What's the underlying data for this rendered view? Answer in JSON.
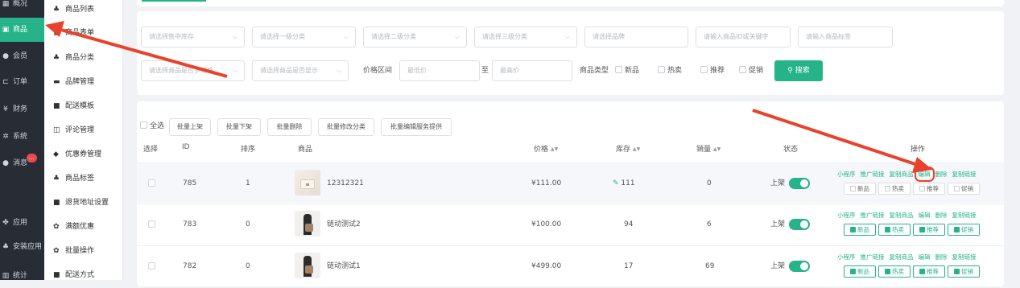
{
  "sidebar_main": [
    {
      "label": "概况",
      "icon": "dashboard-icon"
    },
    {
      "label": "商品",
      "icon": "goods-icon",
      "active": true
    },
    {
      "label": "会员",
      "icon": "users-icon"
    },
    {
      "label": "订单",
      "icon": "cart-icon"
    },
    {
      "label": "财务",
      "icon": "yen-icon"
    },
    {
      "label": "系统",
      "icon": "gears-icon"
    },
    {
      "label": "消息",
      "icon": "chat-icon",
      "badge": "..."
    },
    {
      "label": "应用",
      "icon": "app-icon"
    },
    {
      "label": "安装应用",
      "icon": "install-icon"
    },
    {
      "label": "统计",
      "icon": "chart-icon"
    }
  ],
  "sidebar_sub": [
    {
      "label": "商品列表",
      "icon": "goods-list-icon"
    },
    {
      "label": "商品表单",
      "icon": "form-icon"
    },
    {
      "label": "商品分类",
      "icon": "category-icon"
    },
    {
      "label": "品牌管理",
      "icon": "brand-icon"
    },
    {
      "label": "配送模板",
      "icon": "truck-icon"
    },
    {
      "label": "评论管理",
      "icon": "comment-icon"
    },
    {
      "label": "优惠券管理",
      "icon": "coupon-icon"
    },
    {
      "label": "商品标签",
      "icon": "tag-icon"
    },
    {
      "label": "退货地址设置",
      "icon": "truck-icon"
    },
    {
      "label": "满额优惠",
      "icon": "gift-icon"
    },
    {
      "label": "批量操作",
      "icon": "gift-icon"
    },
    {
      "label": "配送方式",
      "icon": "truck-icon"
    }
  ],
  "filters": {
    "stock_ph": "请选择售中库存",
    "cat1_ph": "请选择一级分类",
    "cat2_ph": "请选择二级分类",
    "cat3_ph": "请选择三级分类",
    "brand_ph": "请选择品牌",
    "keyword_ph": "请输入商品ID或关键字",
    "tag_ph": "请输入商品标签",
    "spec_ph": "请选择商品是否多规格",
    "display_ph": "请选择商品是否显示",
    "price_label": "价格区间",
    "min_ph": "最低价",
    "to": "至",
    "max_ph": "最高价",
    "type_label": "商品类型",
    "type_new": "新品",
    "type_hot": "热卖",
    "type_recommend": "推荐",
    "type_promo": "促销",
    "search": "搜索"
  },
  "toolbar": {
    "select_all": "全选",
    "batch_on": "批量上架",
    "batch_off": "批量下架",
    "batch_delete": "批量删除",
    "batch_category": "批量修改分类",
    "batch_service": "批量编辑服务提供"
  },
  "columns": {
    "select": "选择",
    "id": "ID",
    "sort": "排序",
    "product": "商品",
    "price": "价格",
    "stock": "库存",
    "sales": "销量",
    "status": "状态",
    "ops": "操作"
  },
  "actions": [
    "小程序",
    "推广链接",
    "复制商品",
    "编辑",
    "删除",
    "复制链接"
  ],
  "tag_labels": [
    "新品",
    "热卖",
    "推荐",
    "促销"
  ],
  "rows": [
    {
      "id": "785",
      "sort": "1",
      "name": "12312321",
      "price": "¥111.00",
      "stock": "111",
      "sales": "0",
      "status": "上架",
      "tags": [
        false,
        false,
        false,
        false
      ]
    },
    {
      "id": "783",
      "sort": "0",
      "name": "链动测试2",
      "price": "¥100.00",
      "stock": "94",
      "sales": "6",
      "status": "上架",
      "tags": [
        true,
        true,
        true,
        true
      ]
    },
    {
      "id": "782",
      "sort": "0",
      "name": "链动测试1",
      "price": "¥499.00",
      "stock": "17",
      "sales": "69",
      "status": "上架",
      "tags": [
        true,
        true,
        true,
        true
      ]
    }
  ],
  "colors": {
    "accent": "#27b38a",
    "annotation": "#e8412c"
  }
}
